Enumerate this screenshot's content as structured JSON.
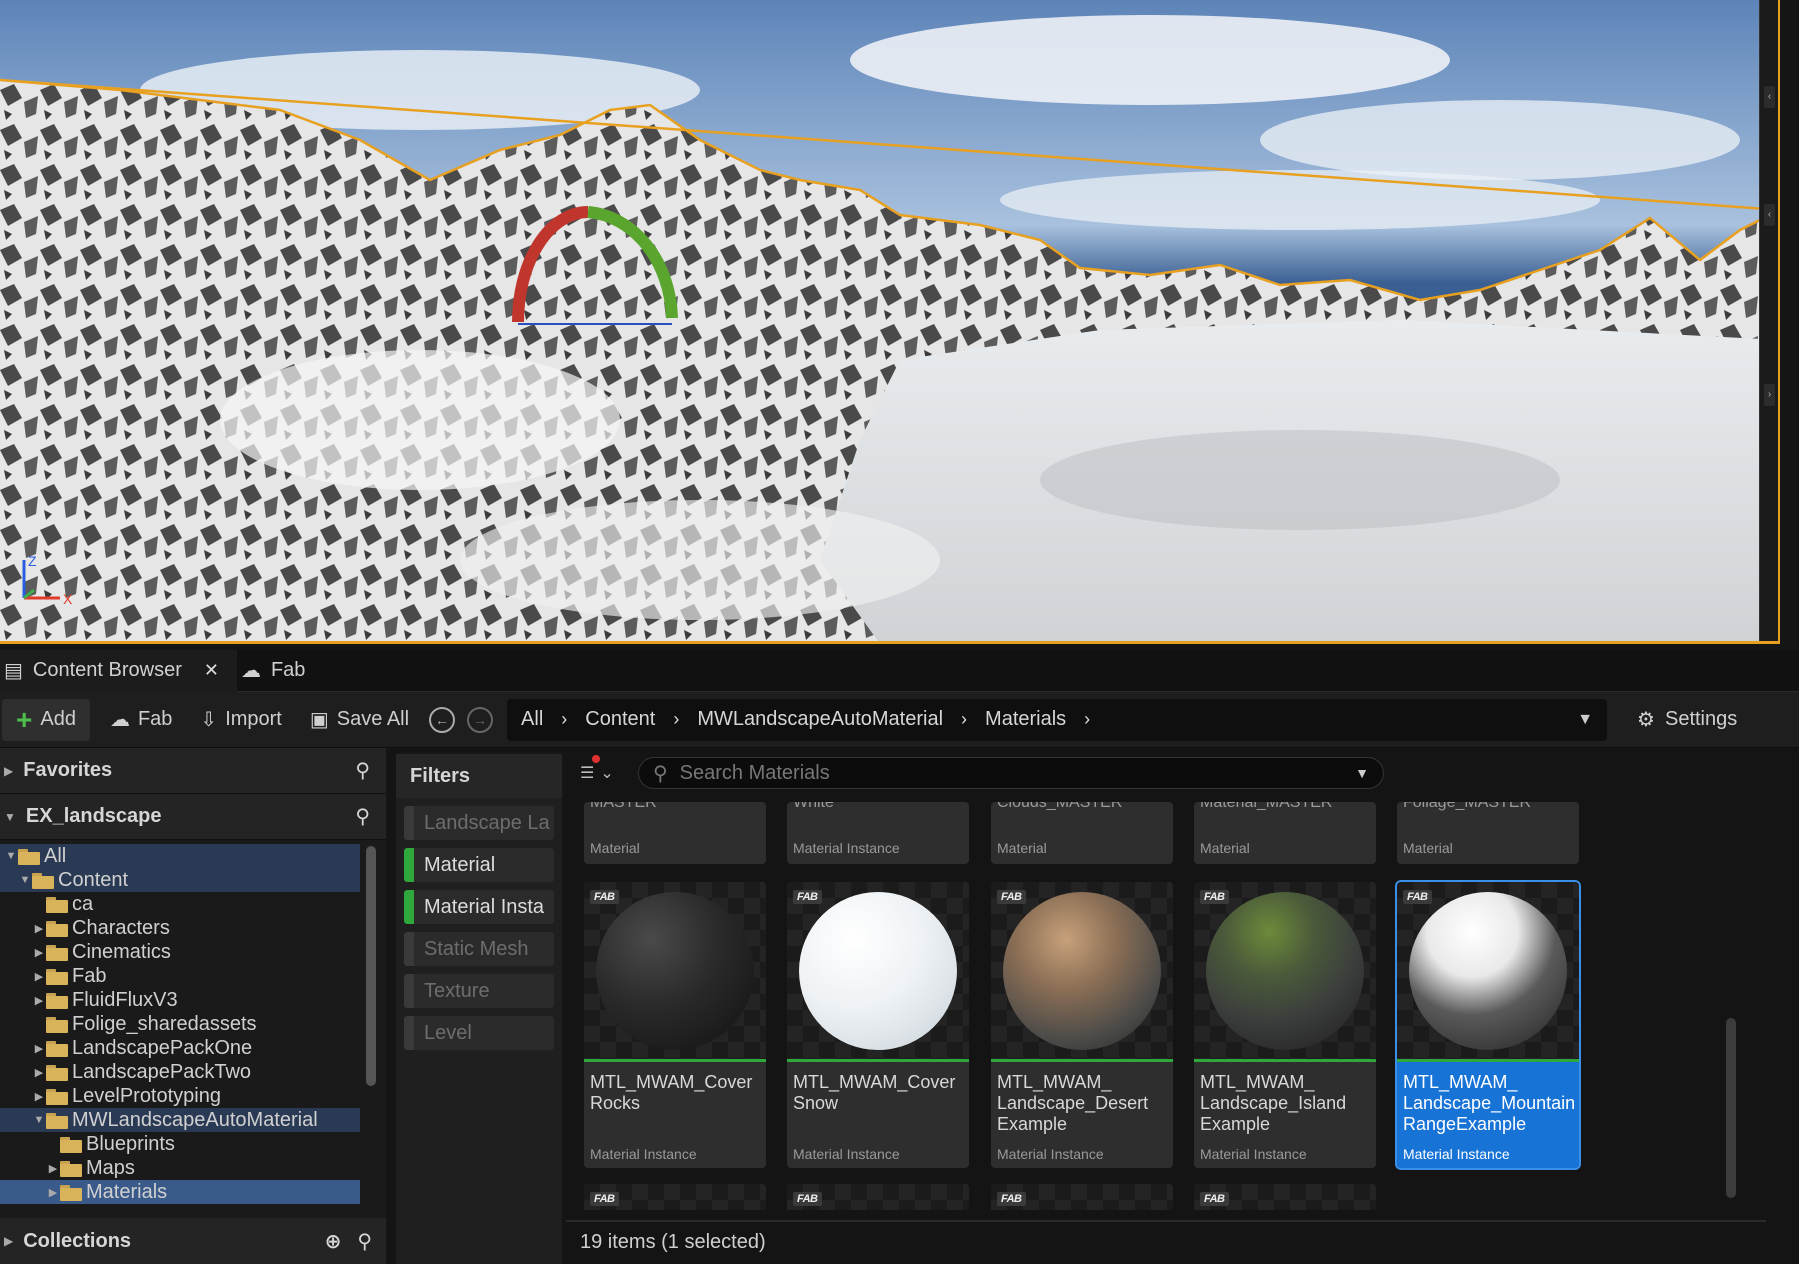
{
  "tabs": {
    "content_browser": "Content Browser",
    "fab": "Fab"
  },
  "toolbar": {
    "add": "Add",
    "fab": "Fab",
    "import": "Import",
    "save_all": "Save All",
    "settings": "Settings",
    "breadcrumb": [
      "All",
      "Content",
      "MWLandscapeAutoMaterial",
      "Materials"
    ]
  },
  "sources": {
    "favorites": "Favorites",
    "project": "EX_landscape",
    "collections": "Collections",
    "tree": [
      {
        "label": "All",
        "depth": 0,
        "arrow": "open",
        "state": "hl"
      },
      {
        "label": "Content",
        "depth": 1,
        "arrow": "open",
        "state": "hl"
      },
      {
        "label": "ca",
        "depth": 2,
        "arrow": "none",
        "state": ""
      },
      {
        "label": "Characters",
        "depth": 2,
        "arrow": "closed",
        "state": ""
      },
      {
        "label": "Cinematics",
        "depth": 2,
        "arrow": "closed",
        "state": ""
      },
      {
        "label": "Fab",
        "depth": 2,
        "arrow": "closed",
        "state": ""
      },
      {
        "label": "FluidFluxV3",
        "depth": 2,
        "arrow": "closed",
        "state": ""
      },
      {
        "label": "Folige_sharedassets",
        "depth": 2,
        "arrow": "none",
        "state": ""
      },
      {
        "label": "LandscapePackOne",
        "depth": 2,
        "arrow": "closed",
        "state": ""
      },
      {
        "label": "LandscapePackTwo",
        "depth": 2,
        "arrow": "closed",
        "state": ""
      },
      {
        "label": "LevelPrototyping",
        "depth": 2,
        "arrow": "closed",
        "state": ""
      },
      {
        "label": "MWLandscapeAutoMaterial",
        "depth": 2,
        "arrow": "open",
        "state": "hl"
      },
      {
        "label": "Blueprints",
        "depth": 3,
        "arrow": "none",
        "state": ""
      },
      {
        "label": "Maps",
        "depth": 3,
        "arrow": "closed",
        "state": ""
      },
      {
        "label": "Materials",
        "depth": 3,
        "arrow": "closed",
        "state": "sel"
      }
    ]
  },
  "filters": {
    "title": "Filters",
    "chips": [
      {
        "label": "Landscape La",
        "on": false
      },
      {
        "label": "Material",
        "on": true
      },
      {
        "label": "Material Insta",
        "on": true
      },
      {
        "label": "Static Mesh",
        "on": false
      },
      {
        "label": "Texture",
        "on": false
      },
      {
        "label": "Level",
        "on": false
      }
    ]
  },
  "assets": {
    "search_placeholder": "Search Materials",
    "status": "19 items (1 selected)",
    "top_row": [
      {
        "cut": "MASTER",
        "type": "Material"
      },
      {
        "cut": "White",
        "type": "Material Instance"
      },
      {
        "cut": "Clouds_MASTER",
        "type": "Material"
      },
      {
        "cut": "Material_MASTER",
        "type": "Material"
      },
      {
        "cut": "Foliage_MASTER",
        "type": "Material"
      }
    ],
    "main_row": [
      {
        "name": "MTL_MWAM_Cover Rocks",
        "type": "Material Instance",
        "sphere": "rocks",
        "selected": false
      },
      {
        "name": "MTL_MWAM_Cover Snow",
        "type": "Material Instance",
        "sphere": "snow",
        "selected": false
      },
      {
        "name": "MTL_MWAM_ Landscape_Desert Example",
        "type": "Material Instance",
        "sphere": "desert",
        "selected": false
      },
      {
        "name": "MTL_MWAM_ Landscape_Island Example",
        "type": "Material Instance",
        "sphere": "island",
        "selected": false
      },
      {
        "name": "MTL_MWAM_ Landscape_Mountain RangeExample",
        "type": "Material Instance",
        "sphere": "mountain",
        "selected": true
      }
    ],
    "fab_badge": "FAB"
  },
  "viewport": {
    "axis_x": "X",
    "axis_z": "Z"
  }
}
